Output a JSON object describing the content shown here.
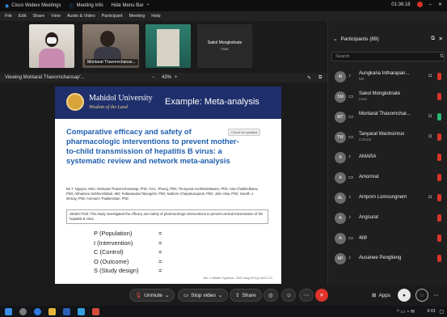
{
  "titlebar": {
    "app": "Cisco Webex Meetings",
    "meeting_info": "Meeting Info",
    "hide_menu": "Hide Menu Bar",
    "timer": "01:36:18"
  },
  "menu": [
    "File",
    "Edit",
    "Share",
    "View",
    "Audio & Video",
    "Participant",
    "Meeting",
    "Help"
  ],
  "video_tiles": [
    {
      "name": "",
      "sub": ""
    },
    {
      "name": "Montarat Thavornchanse...",
      "sub": ""
    },
    {
      "name": "Sakol Mongkolnate",
      "sub": "Host"
    }
  ],
  "viewbar": {
    "viewing": "Viewing Montarat Thavornchansap'...",
    "zoom": "43%",
    "minus": "−",
    "plus": "+"
  },
  "slide": {
    "university": "Mahidol University",
    "motto": "Wisdom of the Land",
    "title": "Example: Meta-analysis",
    "paper_title": "Comparative efficacy and safety of pharmacologic interventions to prevent mother-to-child transmission of hepatitis B virus: a systematic review and network meta-analysis",
    "check_badge": "Check for updates",
    "authors": "Ba T. Nguyen, MSc; Montarat Thavornchanasap, PhD; Yot L. Phung, PhD; Thunyarat Anothaisintawee, PhD; Usa Chaikledkaew, PhD; Abhasnee Sobhonslidsuk, MD; Pattarawalai Talungchit, PhD; Nathorn Chaiyakunapruk, PhD; John Attia, PhD; Gareth J. McKay, PhD; Ammarin Thakkinstian, PhD",
    "objective": "OBJECTIVE: This study investigated the efficacy and safety of pharmacologic interventions to prevent vertical transmission of the hepatitis B virus.",
    "pico": [
      {
        "k": "P (Population)",
        "v": "="
      },
      {
        "k": "I (Intervention)",
        "v": "="
      },
      {
        "k": "C (Control)",
        "v": "="
      },
      {
        "k": "O (Outcome)",
        "v": "="
      },
      {
        "k": "S (Study design)",
        "v": "="
      }
    ],
    "citation": "Am J Obstet Gynecol. 2022 Aug;227(2):163-172."
  },
  "controls": {
    "unmute": "Unmute",
    "stop_video": "Stop video",
    "share": "Share",
    "apps": "Apps"
  },
  "panel": {
    "title": "Participants (89)",
    "search_placeholder": "Search",
    "participants": [
      {
        "name": "Aungkana Intharapan...",
        "sub": "Me",
        "initials": "AI"
      },
      {
        "name": "Sakol Mongkolnate",
        "sub": "Host",
        "initials": "SM"
      },
      {
        "name": "Montarat Thavornchar...",
        "sub": "",
        "initials": "MT"
      },
      {
        "name": "Tanyarat Warinsirirux",
        "sub": "Cohost",
        "initials": "TW"
      },
      {
        "name": "AMARA",
        "sub": "",
        "initials": "A"
      },
      {
        "name": "Amornrat",
        "sub": "",
        "initials": "A"
      },
      {
        "name": "Amporn Lomsungnern",
        "sub": "",
        "initials": "AL"
      },
      {
        "name": "Angsurat",
        "sub": "",
        "initials": "A"
      },
      {
        "name": "app",
        "sub": "",
        "initials": "A"
      },
      {
        "name": "Ausanee Pengtieng",
        "sub": "",
        "initials": "AP"
      }
    ]
  },
  "taskbar": {
    "time": "9:01"
  }
}
